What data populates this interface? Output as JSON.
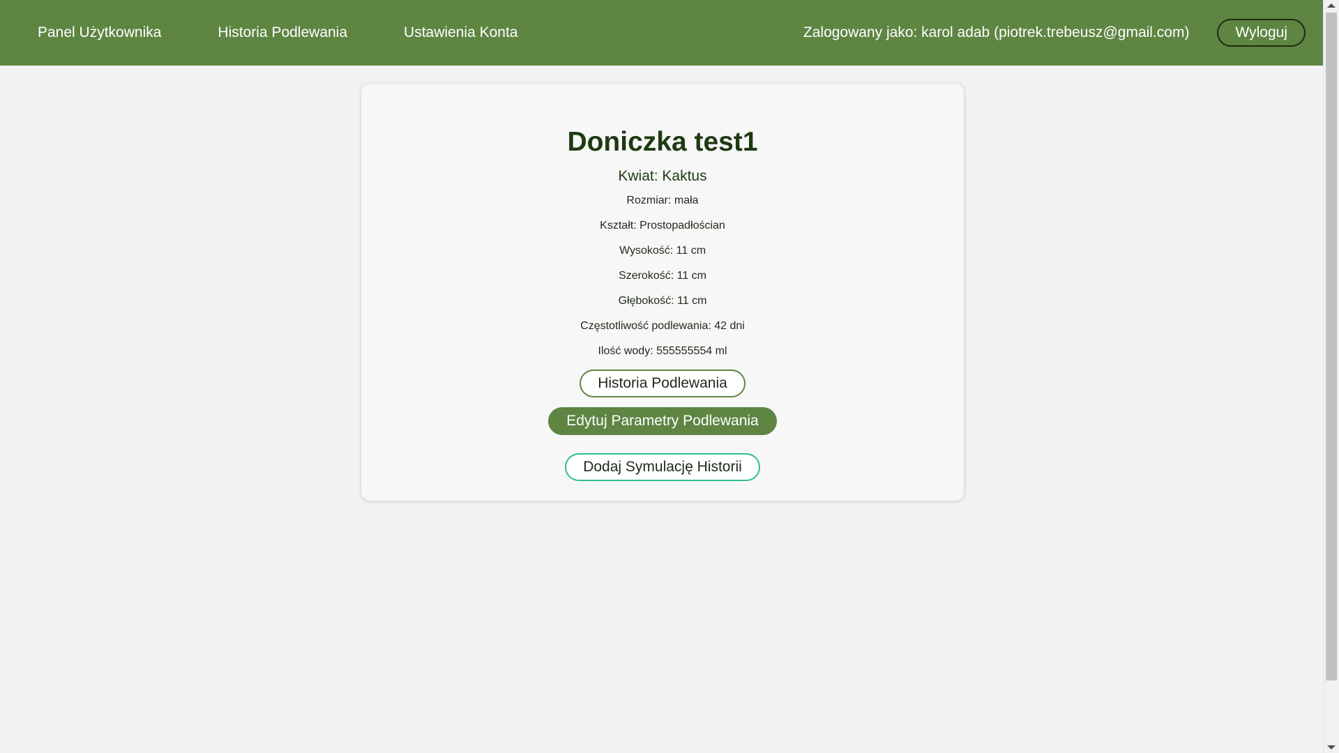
{
  "navbar": {
    "links": [
      "Panel Użytkownika",
      "Historia Podlewania",
      "Ustawienia Konta"
    ],
    "user_info": "Zalogowany jako: karol adab (piotrek.trebeusz@gmail.com)",
    "logout_label": "Wyloguj",
    "color": "#5e8542"
  },
  "pot": {
    "title": "Doniczka test1",
    "flower": "Kwiat: Kaktus",
    "details": [
      "Rozmiar: mała",
      "Kształt: Prostopadłościan",
      "Wysokość: 11 cm",
      "Szerokość: 11 cm",
      "Głębokość: 11 cm",
      "Częstotliwość podlewania: 42 dni",
      "Ilość wody: 555555554 ml"
    ]
  },
  "actions": {
    "history_label": "Historia Podlewania",
    "edit_label": "Edytuj Parametry Podlewania",
    "simulate_label": "Dodaj Symulację Historii"
  }
}
